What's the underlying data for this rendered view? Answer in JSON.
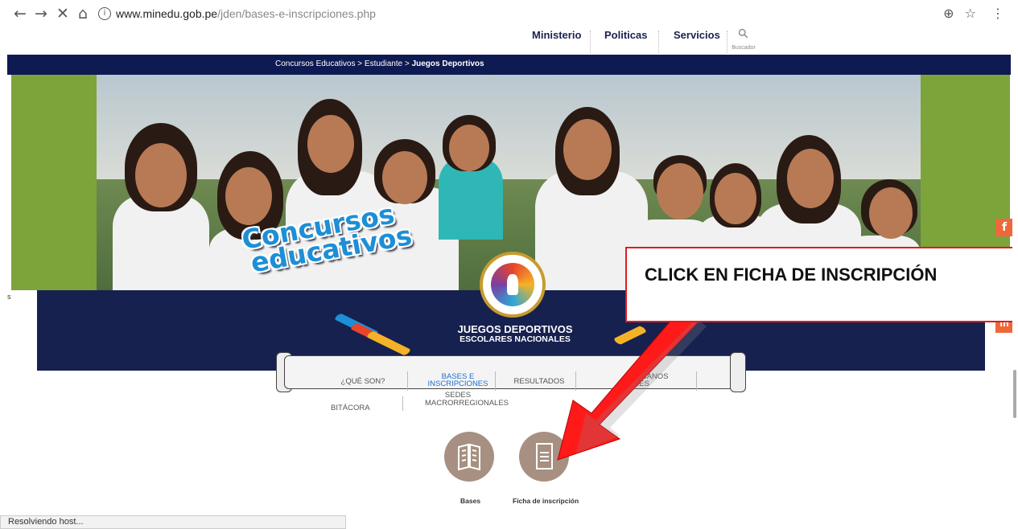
{
  "browser": {
    "url_host": "www.minedu.gob.pe",
    "url_path": "/jden/bases-e-inscripciones.php",
    "back_glyph": "←",
    "forward_glyph": "→",
    "stop_glyph": "✕",
    "home_glyph": "⌂",
    "info_glyph": "i",
    "zoom_glyph": "⊕",
    "star_glyph": "☆",
    "menu_glyph": "⋮"
  },
  "topnav": {
    "items": [
      "Ministerio",
      "Politicas",
      "Servicios"
    ],
    "search_label": "Buscador",
    "search_glyph": "⚲"
  },
  "breadcrumb": {
    "items": [
      "Concursos Educativos",
      "Estudiante",
      "Juegos Deportivos"
    ],
    "separator": " > "
  },
  "hero": {
    "badge_line1": "Concursos",
    "badge_line2": "educativos"
  },
  "event": {
    "title_line1": "JUEGOS DEPORTIVOS",
    "title_line2": "ESCOLARES NACIONALES"
  },
  "menu": {
    "items": [
      {
        "label": "¿QUÉ SON?"
      },
      {
        "label": "BASES E\nINSCRIPCIONES"
      },
      {
        "label": "RESULTADOS"
      },
      {
        "label": "...ERICANOS\n...ARES"
      }
    ],
    "sub_items": [
      {
        "label": "BITÁCORA"
      },
      {
        "label": "SEDES\nMACRORREGIONALES"
      }
    ]
  },
  "downloads": [
    {
      "label": "Bases",
      "icon": "book-icon"
    },
    {
      "label": "Ficha de inscripción",
      "icon": "document-icon"
    }
  ],
  "callout": {
    "text": "CLICK EN FICHA DE INSCRIPCIÓN",
    "border_color": "#e11b1b",
    "arrow_color": "#ff1a1a"
  },
  "social": {
    "facebook_glyph": "f",
    "linkedin_glyph": "in"
  },
  "status_bar": {
    "text": "Resolviendo host..."
  },
  "colors": {
    "navy": "#0e1a52",
    "hero_green": "#7da33b",
    "icon_brown": "#a79081",
    "social_orange": "#f0673a",
    "menu_active": "#1d6fd3"
  }
}
